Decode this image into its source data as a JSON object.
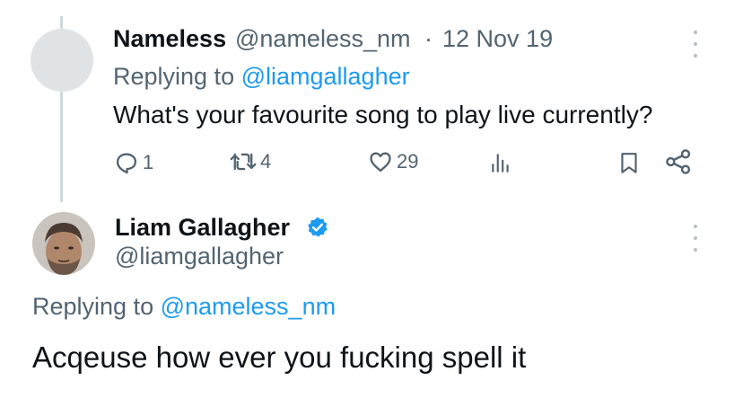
{
  "parent_tweet": {
    "author_name": "Nameless",
    "author_handle": "@nameless_nm",
    "separator": "·",
    "date": "12 Nov 19",
    "replying_prefix": "Replying to ",
    "replying_to": "@liamgallagher",
    "text": "What's your favourite song to play live currently?",
    "replies": "1",
    "retweets": "4",
    "likes": "29"
  },
  "main_tweet": {
    "author_name": "Liam Gallagher",
    "author_handle": "@liamgallagher",
    "verified": true,
    "replying_prefix": "Replying to ",
    "replying_to": "@nameless_nm",
    "text": "Acqeuse how ever you fucking spell it"
  },
  "colors": {
    "accent": "#1d9bf0",
    "secondary_text": "#536471",
    "thread_line": "#cfd9de"
  },
  "icons": [
    "reply-icon",
    "retweet-icon",
    "like-icon",
    "views-icon",
    "bookmark-icon",
    "share-icon",
    "more-icon",
    "verified-badge-icon"
  ]
}
